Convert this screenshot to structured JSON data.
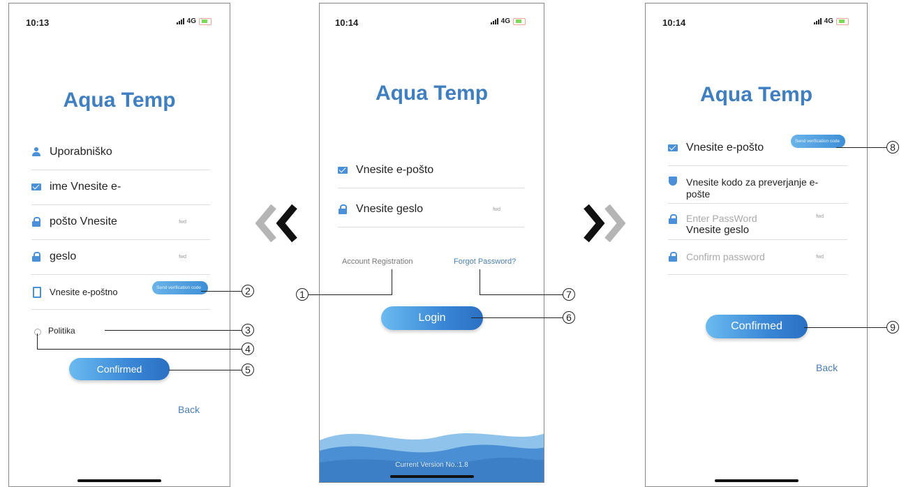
{
  "colors": {
    "brand": "#3f7fc1",
    "button": "#3a87d6"
  },
  "screen1": {
    "time": "10:13",
    "network": "4G",
    "logo": "Aqua Temp",
    "username": "Uporabniško",
    "email": "ime Vnesite e-",
    "password": "pošto Vnesite",
    "confirm": "geslo",
    "eye_hint": "fwd",
    "email_code": "Vnesite e-poštno",
    "send_code": "Send verification code",
    "policy": "Politika",
    "confirm_button": "Confirmed",
    "back": "Back"
  },
  "screen2": {
    "time": "10:14",
    "network": "4G",
    "logo": "Aqua Temp",
    "email": "Vnesite e-pošto",
    "password": "Vnesite geslo",
    "eye_hint": "fwd",
    "register_link": "Account Registration",
    "forgot_link": "Forgot Password?",
    "login_button": "Login",
    "version": "Current Version No.:1.8"
  },
  "screen3": {
    "time": "10:14",
    "network": "4G",
    "logo": "Aqua Temp",
    "email": "Vnesite e-pošto",
    "send_code": "Send verification code",
    "code": "Vnesite kodo za preverjanje e-pošte",
    "password_placeholder": "Enter PassWord",
    "password_overlay": "Vnesite geslo",
    "confirm_placeholder": "Confirm password",
    "eye_hint": "fwd",
    "confirm_button": "Confirmed",
    "back": "Back"
  },
  "callouts": [
    "1",
    "2",
    "3",
    "4",
    "5",
    "6",
    "7",
    "8",
    "9"
  ]
}
